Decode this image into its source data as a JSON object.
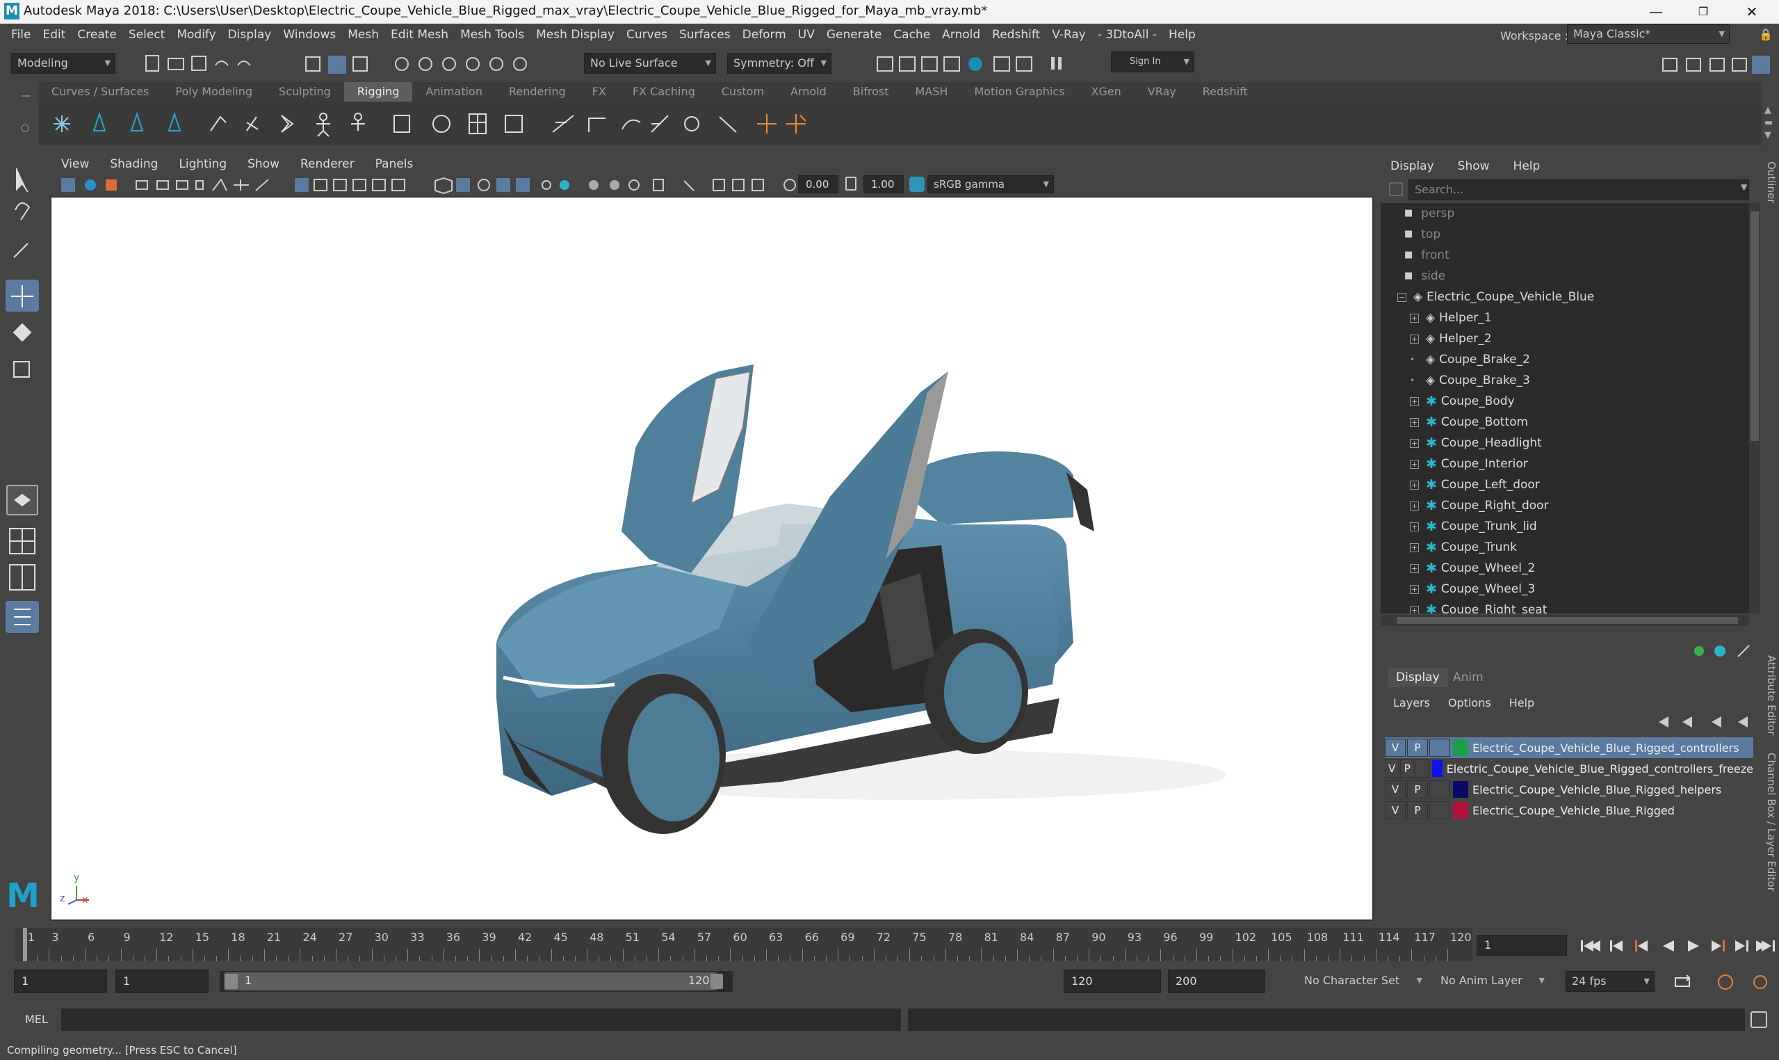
{
  "window": {
    "title": "Autodesk Maya 2018: C:\\Users\\User\\Desktop\\Electric_Coupe_Vehicle_Blue_Rigged_max_vray\\Electric_Coupe_Vehicle_Blue_Rigged_for_Maya_mb_vray.mb*",
    "logo": "M",
    "minimize": "—",
    "maximize": "❐",
    "close": "✕"
  },
  "menubar": {
    "items": [
      "File",
      "Edit",
      "Create",
      "Select",
      "Modify",
      "Display",
      "Windows",
      "Mesh",
      "Edit Mesh",
      "Mesh Tools",
      "Mesh Display",
      "Curves",
      "Surfaces",
      "Deform",
      "UV",
      "Generate",
      "Cache",
      "Arnold",
      "Redshift",
      "V-Ray",
      "- 3DtoAll -",
      "Help"
    ],
    "workspace_label": "Workspace :",
    "workspace_value": "Maya Classic*"
  },
  "statusline": {
    "mode": "Modeling",
    "live_surface": "No Live Surface",
    "symmetry": "Symmetry: Off",
    "sign_in": "Sign In"
  },
  "shelf": {
    "tabs": [
      "Curves / Surfaces",
      "Poly Modeling",
      "Sculpting",
      "Rigging",
      "Animation",
      "Rendering",
      "FX",
      "FX Caching",
      "Custom",
      "Arnold",
      "Bifrost",
      "MASH",
      "Motion Graphics",
      "XGen",
      "VRay",
      "Redshift"
    ],
    "active_tab": "Rigging"
  },
  "viewport": {
    "menu": [
      "View",
      "Shading",
      "Lighting",
      "Show",
      "Renderer",
      "Panels"
    ],
    "exposure": "0.00",
    "gamma": "1.00",
    "color_space": "sRGB gamma",
    "axis_y": "y",
    "axis_z": "z",
    "axis_x": "x",
    "car_color": "#4a7a96"
  },
  "outliner": {
    "menu": [
      "Display",
      "Show",
      "Help"
    ],
    "search_placeholder": "Search...",
    "cameras": [
      "persp",
      "top",
      "front",
      "side"
    ],
    "root": "Electric_Coupe_Vehicle_Blue",
    "children": [
      {
        "label": "Helper_1",
        "icon": "transform-icon",
        "expandable": true
      },
      {
        "label": "Helper_2",
        "icon": "transform-icon",
        "expandable": true
      },
      {
        "label": "Coupe_Brake_2",
        "icon": "transform-icon",
        "expandable": false
      },
      {
        "label": "Coupe_Brake_3",
        "icon": "transform-icon",
        "expandable": false
      },
      {
        "label": "Coupe_Body",
        "icon": "joint-icon",
        "expandable": true
      },
      {
        "label": "Coupe_Bottom",
        "icon": "joint-icon",
        "expandable": true
      },
      {
        "label": "Coupe_Headlight",
        "icon": "joint-icon",
        "expandable": true
      },
      {
        "label": "Coupe_Interior",
        "icon": "joint-icon",
        "expandable": true
      },
      {
        "label": "Coupe_Left_door",
        "icon": "joint-icon",
        "expandable": true
      },
      {
        "label": "Coupe_Right_door",
        "icon": "joint-icon",
        "expandable": true
      },
      {
        "label": "Coupe_Trunk_lid",
        "icon": "joint-icon",
        "expandable": true
      },
      {
        "label": "Coupe_Trunk",
        "icon": "joint-icon",
        "expandable": true
      },
      {
        "label": "Coupe_Wheel_2",
        "icon": "joint-icon",
        "expandable": true
      },
      {
        "label": "Coupe_Wheel_3",
        "icon": "joint-icon",
        "expandable": true
      },
      {
        "label": "Coupe_Right_seat",
        "icon": "joint-icon",
        "expandable": true
      }
    ]
  },
  "layer_editor": {
    "tabs": [
      "Display",
      "Anim"
    ],
    "menu": [
      "Layers",
      "Options",
      "Help"
    ],
    "layers": [
      {
        "v": "V",
        "p": "P",
        "color": "#1e9e4a",
        "name": "Electric_Coupe_Vehicle_Blue_Rigged_controllers",
        "selected": true
      },
      {
        "v": "V",
        "p": "P",
        "color": "#1010f0",
        "name": "Electric_Coupe_Vehicle_Blue_Rigged_controllers_freeze",
        "selected": false
      },
      {
        "v": "V",
        "p": "P",
        "color": "#0a0a66",
        "name": "Electric_Coupe_Vehicle_Blue_Rigged_helpers",
        "selected": false
      },
      {
        "v": "V",
        "p": "P",
        "color": "#b0103a",
        "name": "Electric_Coupe_Vehicle_Blue_Rigged",
        "selected": false
      }
    ]
  },
  "side_tabs": [
    "Outliner",
    "Attribute Editor",
    "Channel Box / Layer Editor"
  ],
  "time_slider": {
    "ticks": [
      "1",
      "3",
      "6",
      "9",
      "12",
      "15",
      "18",
      "21",
      "24",
      "27",
      "30",
      "33",
      "36",
      "39",
      "42",
      "45",
      "48",
      "51",
      "54",
      "57",
      "60",
      "63",
      "66",
      "69",
      "72",
      "75",
      "78",
      "81",
      "84",
      "87",
      "90",
      "93",
      "96",
      "99",
      "102",
      "105",
      "108",
      "111",
      "114",
      "117",
      "120"
    ],
    "current_frame": "1"
  },
  "range_slider": {
    "start": "1",
    "playback_start": "1",
    "range_start_label": "1",
    "range_end_label": "120",
    "playback_end": "120",
    "end": "200",
    "character_set": "No Character Set",
    "anim_layer": "No Anim Layer",
    "fps": "24 fps"
  },
  "command_line": {
    "label": "MEL"
  },
  "help_line": "Compiling geometry... [Press ESC to Cancel]"
}
